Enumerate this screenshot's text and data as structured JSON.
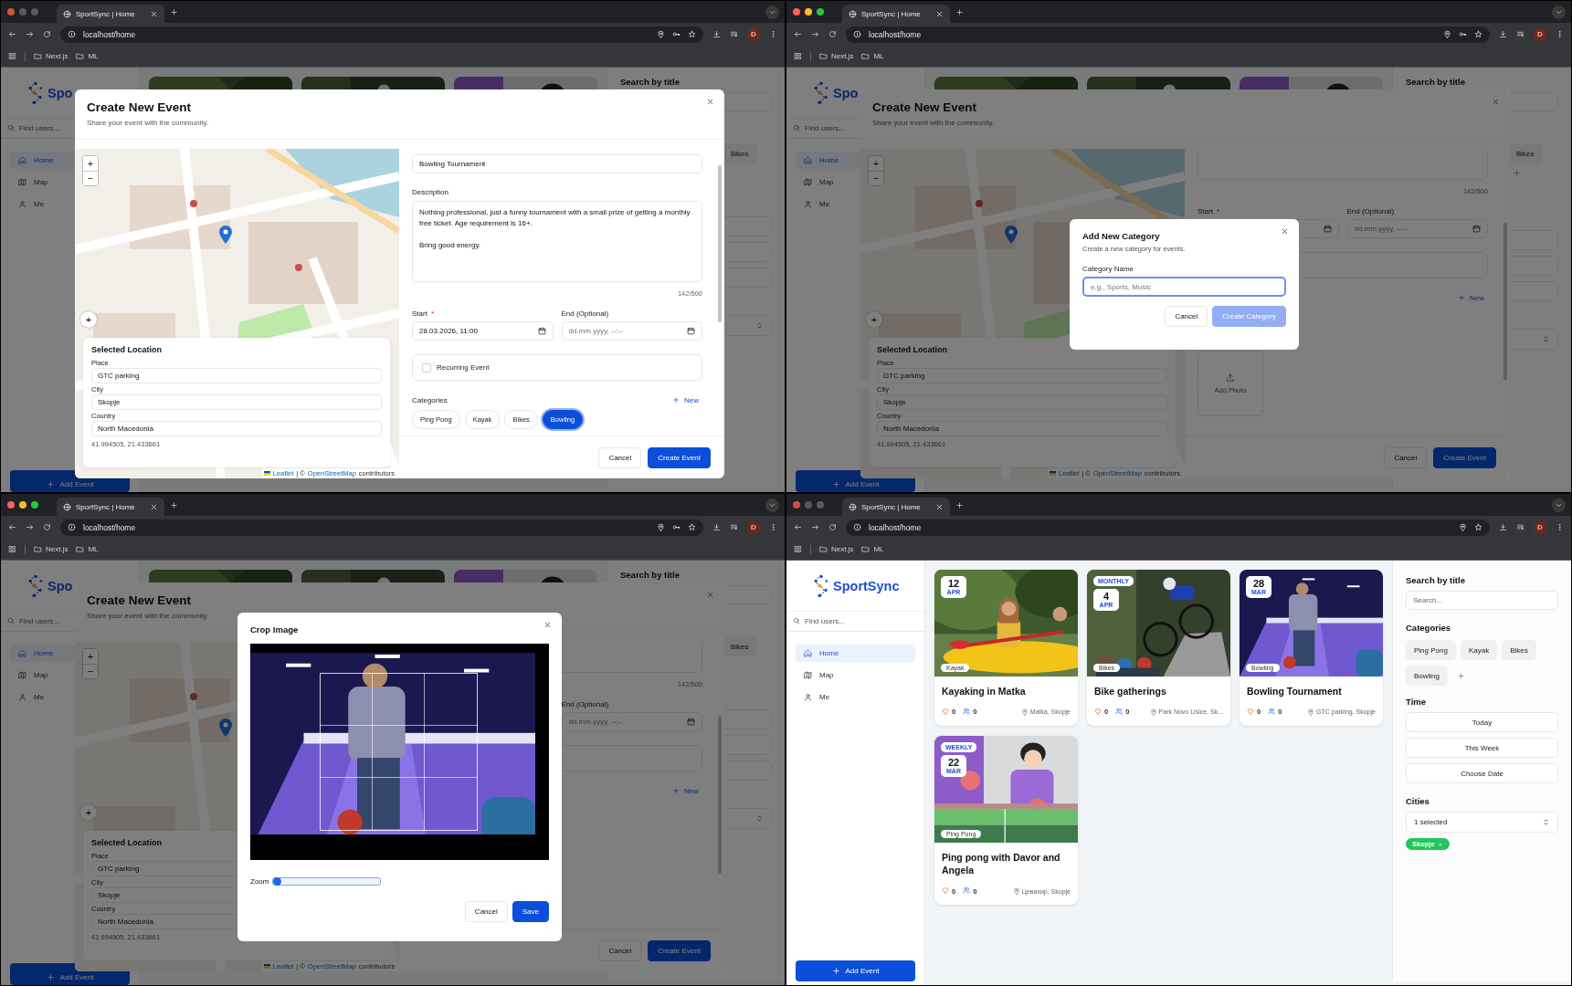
{
  "windows": [
    {
      "kind": "event_form",
      "chrome": {
        "active": false,
        "tab_title": "SportSync | Home",
        "url": "localhost/home",
        "bookmarks": [
          "Next.js",
          "ML"
        ],
        "profile": "D"
      },
      "backdrop": {
        "logo_text": "Spo",
        "find_placeholder": "Find users...",
        "nav": [
          {
            "label": "Home",
            "selected": true
          },
          {
            "label": "Map",
            "selected": false
          },
          {
            "label": "Me",
            "selected": false
          }
        ],
        "add_event": "Add Event",
        "search_title": "Search by title",
        "chips": [
          "Bikes"
        ],
        "add_chip": false
      },
      "modal": {
        "title": "Create New Event",
        "subtitle": "Share your event with the community.",
        "scrolled": false,
        "map": {
          "zoom_in": "+",
          "zoom_out": "−",
          "locate": "+",
          "attribution": {
            "leaflet": "Leaflet",
            "middle": "| ©",
            "osm": "OpenStreetMap",
            "tail": "contributors"
          },
          "location": {
            "title": "Selected Location",
            "fields": [
              {
                "label": "Place",
                "value": "GTC parking"
              },
              {
                "label": "City",
                "value": "Skopje"
              },
              {
                "label": "Country",
                "value": "North Macedonia"
              }
            ],
            "coords": "41.994505, 21.433661"
          }
        },
        "form": {
          "title_value": "Bowling Tournament",
          "description_label": "Description",
          "description_value": "Nothing professional, just a funny tournament with a small prize of getting a monthly free ticket. Age requirement is 16+.\n\nBring good energy.",
          "counter": "142/500",
          "start_label": "Start",
          "required_mark": "*",
          "start_value": "28.03.2026, 11:00",
          "end_label": "End (Optional)",
          "end_placeholder": "dd.mm.yyyy, --:--",
          "recurring": {
            "label": "Recurring Event",
            "checked": false
          },
          "categories_label": "Categories",
          "new_label": "New",
          "categories": [
            {
              "label": "Ping Pong",
              "selected": false
            },
            {
              "label": "Kayak",
              "selected": false
            },
            {
              "label": "Bikes",
              "selected": false
            },
            {
              "label": "Bowling",
              "selected": true
            }
          ]
        },
        "cancel": "Cancel",
        "submit": "Create Event"
      }
    },
    {
      "kind": "event_form",
      "chrome": {
        "active": true,
        "tab_title": "SportSync | Home",
        "url": "localhost/home",
        "bookmarks": [
          "Next.js",
          "ML"
        ],
        "profile": "D"
      },
      "backdrop": {
        "logo_text": "Spo",
        "find_placeholder": "Find users...",
        "nav": [
          {
            "label": "Home",
            "selected": true
          },
          {
            "label": "Map",
            "selected": false
          },
          {
            "label": "Me",
            "selected": false
          }
        ],
        "add_event": "Add Event",
        "search_title": "Search by title",
        "chips": [
          "Bikes"
        ],
        "add_chip": true
      },
      "modal": {
        "title": "Create New Event",
        "subtitle": "Share your event with the community.",
        "scrolled": true,
        "map": {
          "zoom_in": "+",
          "zoom_out": "−",
          "locate": "+",
          "attribution": {
            "leaflet": "Leaflet",
            "middle": "| ©",
            "osm": "OpenStreetMap",
            "tail": "contributors"
          },
          "location": {
            "title": "Selected Location",
            "fields": [
              {
                "label": "Place",
                "value": "GTC parking"
              },
              {
                "label": "City",
                "value": "Skopje"
              },
              {
                "label": "Country",
                "value": "North Macedonia"
              }
            ],
            "coords": "41.994505, 21.433661"
          }
        },
        "form": {
          "counter": "142/500",
          "start_label": "Start",
          "required_mark": "*",
          "end_label": "End (Optional)",
          "end_placeholder": "dd.mm.yyyy, --:--",
          "new_label": "New",
          "add_photo": "Add Photo"
        },
        "cancel": "Cancel",
        "submit": "Create Event"
      },
      "dialog": {
        "kind": "category",
        "title": "Add New Category",
        "subtitle": "Create a new category for events.",
        "field_label": "Category Name",
        "placeholder": "e.g., Sports, Music",
        "cancel": "Cancel",
        "create": {
          "label": "Create Category",
          "disabled": true
        }
      }
    },
    {
      "kind": "event_form",
      "chrome": {
        "active": true,
        "tab_title": "SportSync | Home",
        "url": "localhost/home",
        "bookmarks": [
          "Next.js",
          "ML"
        ],
        "profile": "D"
      },
      "backdrop": {
        "logo_text": "Spo",
        "find_placeholder": "Find users...",
        "nav": [
          {
            "label": "Home",
            "selected": true
          },
          {
            "label": "Map",
            "selected": false
          },
          {
            "label": "Me",
            "selected": false
          }
        ],
        "add_event": "Add Event",
        "search_title": "Search by title",
        "chips": [
          "Bikes"
        ],
        "add_chip": false
      },
      "modal": {
        "title": "Create New Event",
        "subtitle": "Share your event with the community.",
        "scrolled": true,
        "map": {
          "zoom_in": "+",
          "zoom_out": "−",
          "locate": "+",
          "attribution": {
            "leaflet": "Leaflet",
            "middle": "| ©",
            "osm": "OpenStreetMap",
            "tail": "contributors"
          },
          "location": {
            "title": "Selected Location",
            "fields": [
              {
                "label": "Place",
                "value": "GTC parking"
              },
              {
                "label": "City",
                "value": "Skopje"
              },
              {
                "label": "Country",
                "value": "North Macedonia"
              }
            ],
            "coords": "41.994505, 21.433661"
          }
        },
        "form": {
          "counter": "142/500",
          "end_label": "End (Optional)",
          "end_placeholder": "dd.mm.yyyy, --:--",
          "new_label": "New"
        },
        "cancel": "Cancel",
        "submit": "Create Event"
      },
      "dialog": {
        "kind": "crop",
        "title": "Crop Image",
        "zoom_label": "Zoom",
        "zoom": {
          "level": 0
        },
        "cancel": "Cancel",
        "save": "Save"
      }
    },
    {
      "kind": "home",
      "chrome": {
        "active": false,
        "tab_title": "SportSync | Home",
        "url": "localhost/home",
        "bookmarks": [
          "Next.js",
          "ML"
        ],
        "profile": "D"
      },
      "sidebar": {
        "logo_text": "SportSync",
        "find_placeholder": "Find users...",
        "nav": [
          {
            "label": "Home",
            "selected": true
          },
          {
            "label": "Map",
            "selected": false
          },
          {
            "label": "Me",
            "selected": false
          }
        ],
        "add_event": "Add Event"
      },
      "cards": [
        {
          "day": "12",
          "month": "APR",
          "category": "Kayak",
          "title": "Kayaking in Matka",
          "likes": "0",
          "participants": "0",
          "location": "Matka, Skopje"
        },
        {
          "recurrence": "MONTHLY",
          "day": "4",
          "month": "APR",
          "category": "Bikes",
          "title": "Bike gatherings",
          "likes": "0",
          "participants": "0",
          "location": "Park Novo Lisice, Sk..."
        },
        {
          "day": "28",
          "month": "MAR",
          "category": "Bowling",
          "title": "Bowling Tournament",
          "likes": "0",
          "participants": "0",
          "location": "GTC parking, Skopje"
        },
        {
          "recurrence": "WEEKLY",
          "day": "22",
          "month": "MAR",
          "category": "Ping Pong",
          "title": "Ping pong with Davor and Angela",
          "likes": "0",
          "participants": "0",
          "location": "Цевахир, Skopje"
        }
      ],
      "filters": {
        "search_title": "Search by title",
        "search_placeholder": "Search...",
        "categories_title": "Categories",
        "categories": [
          "Ping Pong",
          "Kayak",
          "Bikes",
          "Bowling"
        ],
        "time_title": "Time",
        "time_options": [
          "Today",
          "This Week",
          "Choose Date"
        ],
        "cities_title": "Cities",
        "cities_value": "1 selected",
        "city_tags": [
          "Skopje"
        ]
      }
    }
  ]
}
